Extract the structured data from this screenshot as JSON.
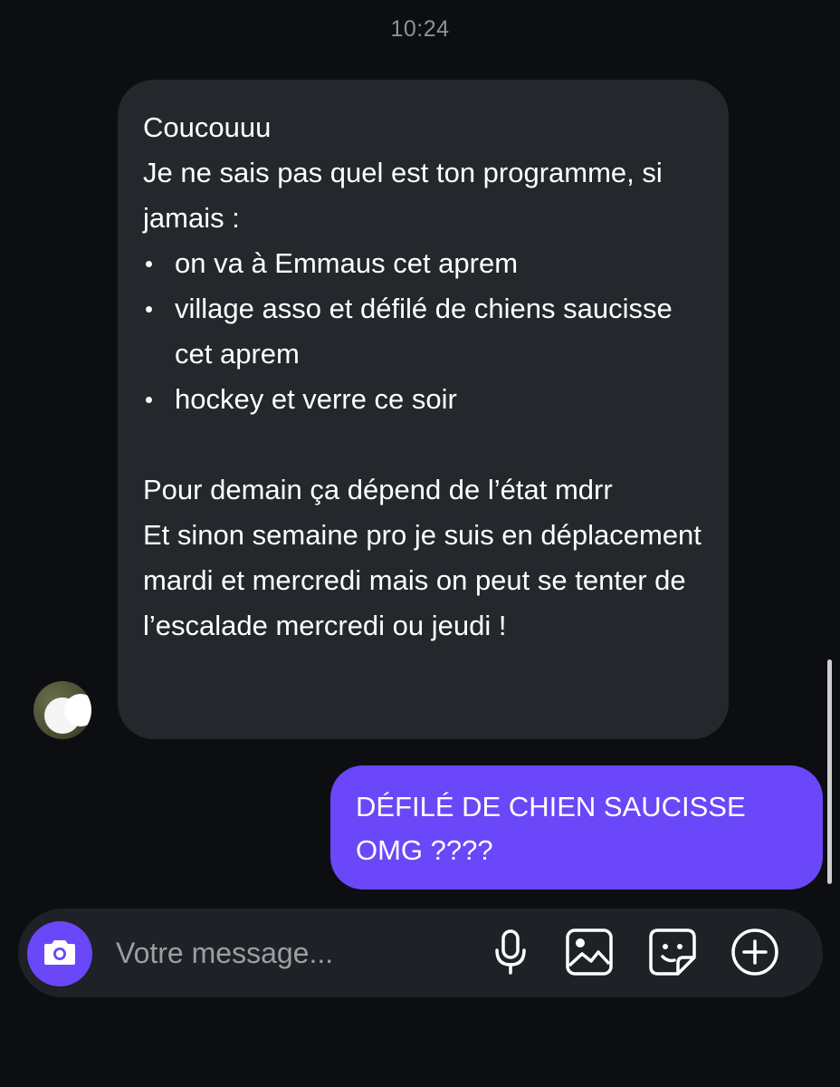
{
  "conversation": {
    "timestamp": "10:24",
    "incoming_message": {
      "greeting": "Coucouuu",
      "intro": "Je ne sais pas quel est ton programme, si jamais :",
      "bullets": [
        "on va à Emmaus cet aprem",
        "village asso et défilé de chiens saucisse cet aprem",
        "hockey et verre ce soir"
      ],
      "paragraph_1": "Pour demain ça dépend de l’état mdrr",
      "paragraph_2": "Et sinon semaine pro je suis en déplacement mardi et mercredi mais on peut se tenter de l’escalade mercredi ou jeudi !"
    },
    "outgoing_message": {
      "text": "DÉFILÉ DE CHIEN SAUCISSE OMG ????"
    }
  },
  "composer": {
    "placeholder": "Votre message...",
    "camera_icon": "camera-icon",
    "actions": [
      "microphone-icon",
      "image-icon",
      "sticker-icon",
      "plus-circle-icon"
    ]
  },
  "colors": {
    "background": "#0c0e11",
    "incoming_bubble": "#24272b",
    "outgoing_bubble": "#6a47f8",
    "composer": "#1e2125",
    "timestamp": "#8e9296"
  }
}
